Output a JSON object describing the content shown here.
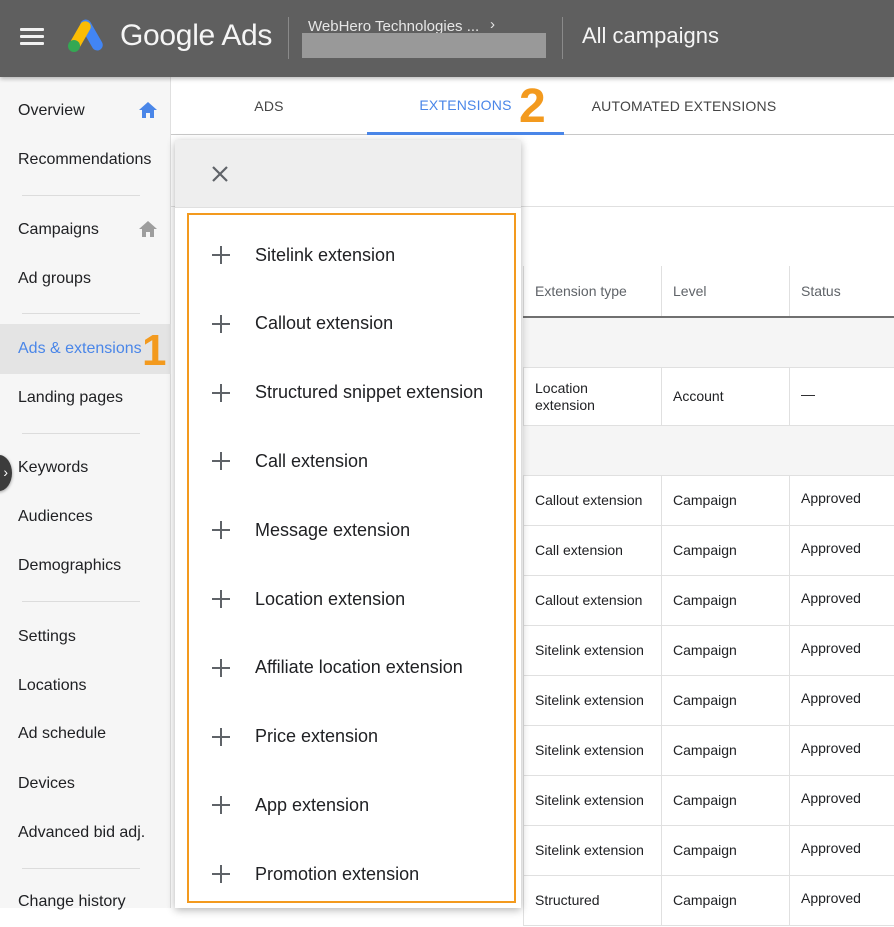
{
  "topbar": {
    "brand": "Google Ads",
    "account_name": "WebHero Technologies ...",
    "account_chevron": "›",
    "page_title": "All campaigns",
    "logo_colors": {
      "blue": "#4285f4",
      "yellow": "#fbbc04",
      "green": "#34a853"
    }
  },
  "sidebar": {
    "items": [
      {
        "label": "Overview",
        "icon": "home-icon",
        "icon_color": "#4a86e8"
      },
      {
        "label": "Recommendations"
      },
      {
        "label": "Campaigns",
        "icon": "home-icon",
        "icon_color": "#9e9e9e"
      },
      {
        "label": "Ad groups"
      },
      {
        "label": "Ads & extensions",
        "active": true
      },
      {
        "label": "Landing pages"
      },
      {
        "label": "Keywords"
      },
      {
        "label": "Audiences"
      },
      {
        "label": "Demographics"
      },
      {
        "label": "Settings"
      },
      {
        "label": "Locations"
      },
      {
        "label": "Ad schedule"
      },
      {
        "label": "Devices"
      },
      {
        "label": "Advanced bid adj."
      },
      {
        "label": "Change history"
      }
    ],
    "annotation": "1"
  },
  "tabs": {
    "items": [
      {
        "label": "ADS"
      },
      {
        "label": "EXTENSIONS",
        "active": true
      },
      {
        "label": "AUTOMATED EXTENSIONS"
      }
    ],
    "annotation": "2",
    "accent_color": "#4a86e8"
  },
  "menu": {
    "close_icon": "close-icon",
    "highlight_color": "#f39a1e",
    "items": [
      {
        "label": "Sitelink extension"
      },
      {
        "label": "Callout extension"
      },
      {
        "label": "Structured snippet extension"
      },
      {
        "label": "Call extension"
      },
      {
        "label": "Message extension"
      },
      {
        "label": "Location extension"
      },
      {
        "label": "Affiliate location extension"
      },
      {
        "label": "Price extension"
      },
      {
        "label": "App extension"
      },
      {
        "label": "Promotion extension"
      }
    ]
  },
  "table": {
    "columns": [
      "Extension type",
      "Level",
      "Status"
    ],
    "rows": [
      {
        "type": "group"
      },
      {
        "extension_type": "Location extension",
        "level": "Account",
        "status": "—"
      },
      {
        "type": "group"
      },
      {
        "extension_type": "Callout extension",
        "level": "Campaign",
        "status": "Approved"
      },
      {
        "extension_type": "Call extension",
        "level": "Campaign",
        "status": "Approved"
      },
      {
        "extension_type": "Callout extension",
        "level": "Campaign",
        "status": "Approved"
      },
      {
        "extension_type": "Sitelink extension",
        "level": "Campaign",
        "status": "Approved"
      },
      {
        "extension_type": "Sitelink extension",
        "level": "Campaign",
        "status": "Approved"
      },
      {
        "extension_type": "Sitelink extension",
        "level": "Campaign",
        "status": "Approved"
      },
      {
        "extension_type": "Sitelink extension",
        "level": "Campaign",
        "status": "Approved"
      },
      {
        "extension_type": "Sitelink extension",
        "level": "Campaign",
        "status": "Approved"
      },
      {
        "extension_type": "Structured",
        "level": "Campaign",
        "status": "Approved"
      }
    ]
  }
}
